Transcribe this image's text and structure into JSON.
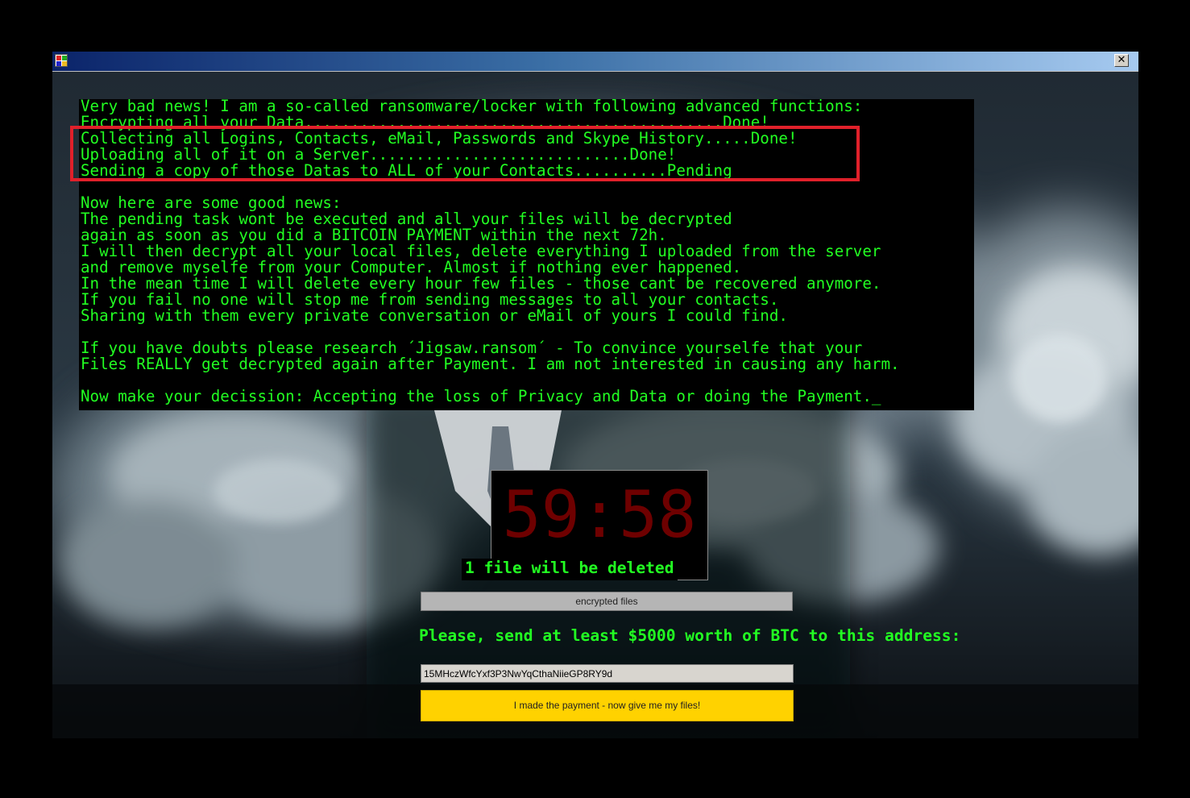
{
  "window": {
    "icon": "app-window-icon",
    "close_icon": "close-icon",
    "close_glyph": "✕"
  },
  "message": {
    "lines": [
      "Very bad news! I am a so-called ransomware/locker with following advanced functions:",
      "Encrypting all your Data.............................................Done!",
      "Collecting all Logins, Contacts, eMail, Passwords and Skype History.....Done!",
      "Uploading all of it on a Server............................Done!",
      "Sending a copy of those Datas to ALL of your Contacts..........Pending",
      "",
      "Now here are some good news:",
      "The pending task wont be executed and all your files will be decrypted",
      "again as soon as you did a BITCOIN PAYMENT within the next 72h.",
      "I will then decrypt all your local files, delete everything I uploaded from the server",
      "and remove myselfe from your Computer. Almost if nothing ever happened.",
      "In the mean time I will delete every hour few files - those cant be recovered anymore.",
      "If you fail no one will stop me from sending messages to all your contacts.",
      "Sharing with them every private conversation or eMail of yours I could find.",
      "",
      "If you have doubts please research ´Jigsaw.ransom´ - To convince yourselfe that your",
      "Files REALLY get decrypted again after Payment. I am not interested in causing any harm.",
      "",
      "Now make your decission: Accepting the loss of Privacy and Data or doing the Payment._"
    ],
    "highlight_color": "#e0202a",
    "text_color": "#22ff22"
  },
  "timer": {
    "value": "59:58",
    "color": "#6e0000"
  },
  "delete_notice": "1 file will be deleted",
  "progress": {
    "label": "encrypted files",
    "fraction": 0.0
  },
  "payment": {
    "instruction": "Please, send at least $5000 worth of BTC to this address:",
    "address": "15MHczWfcYxf3P3NwYqCthaNiieGP8RY9d",
    "button_label": "I made the payment - now give me my files!",
    "button_color": "#ffd200"
  }
}
